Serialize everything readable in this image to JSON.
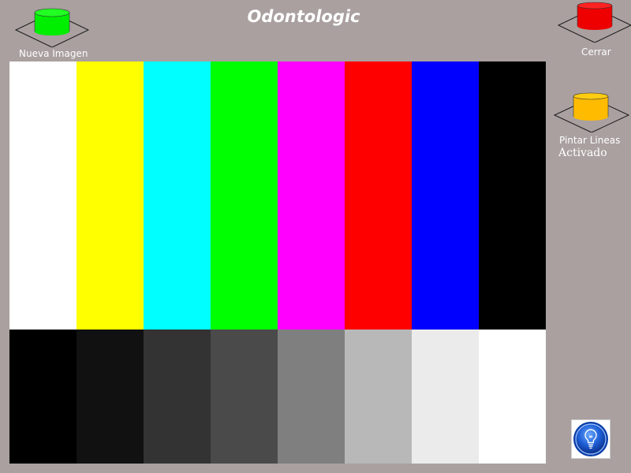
{
  "app": {
    "title": "Odontologic"
  },
  "buttons": {
    "new_image": {
      "label": "Nueva Imagen",
      "cap_color": "#00ee00",
      "cap_top_color": "#22ff22",
      "icon": "green-cylinder-button-icon"
    },
    "close": {
      "label": "Cerrar",
      "cap_color": "#ee0000",
      "cap_top_color": "#ff2222",
      "icon": "red-cylinder-button-icon"
    },
    "paint_lines": {
      "label": "Pintar Lineas",
      "cap_color": "#ffbb00",
      "cap_top_color": "#ffcc11",
      "icon": "orange-cylinder-button-icon"
    },
    "help": {
      "icon": "lightbulb-icon"
    }
  },
  "status": {
    "paint_lines_state": "Activado"
  },
  "canvas": {
    "top_bars": [
      "#ffffff",
      "#ffff00",
      "#00ffff",
      "#00ff00",
      "#ff00ff",
      "#ff0000",
      "#0000ff",
      "#000000"
    ],
    "bottom_bars": [
      "#000000",
      "#111111",
      "#333333",
      "#4a4a4a",
      "#7f7f7f",
      "#b8b8b8",
      "#ebebeb",
      "#ffffff"
    ]
  }
}
